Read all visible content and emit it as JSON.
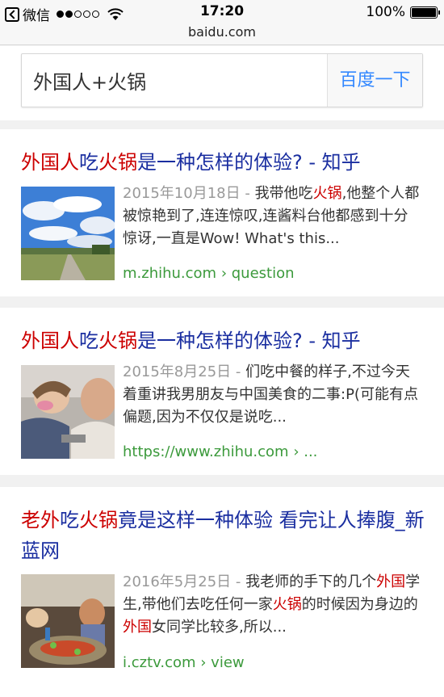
{
  "status_bar": {
    "back_app": "微信",
    "time": "17:20",
    "battery_text": "100%",
    "battery_level": 1.0,
    "signal_bars_filled": 2,
    "signal_bars_total": 5
  },
  "url_bar": {
    "domain": "baidu.com"
  },
  "search": {
    "query": "外国人+火锅",
    "button_label": "百度一下"
  },
  "results": [
    {
      "title": [
        {
          "t": "外国人",
          "hl": true
        },
        {
          "t": "吃",
          "hl": false
        },
        {
          "t": "火锅",
          "hl": true
        },
        {
          "t": "是一种怎样的体验? - 知乎",
          "hl": false
        }
      ],
      "thumb": "sky-field-photo",
      "snippet": [
        {
          "t": "2015年10月18日 - ",
          "cls": "date"
        },
        {
          "t": "我带他吃",
          "cls": ""
        },
        {
          "t": "火锅",
          "cls": "hl"
        },
        {
          "t": ",他整个人都被惊艳到了,连连惊叹,连酱料台他都感到十分惊讶,一直是Wow! What's this...",
          "cls": ""
        }
      ],
      "url": "m.zhihu.com › question"
    },
    {
      "title": [
        {
          "t": "外国人",
          "hl": true
        },
        {
          "t": "吃",
          "hl": false
        },
        {
          "t": "火锅",
          "hl": true
        },
        {
          "t": "是一种怎样的体验? - 知乎",
          "hl": false
        }
      ],
      "thumb": "people-photo",
      "snippet": [
        {
          "t": "2015年8月25日 - ",
          "cls": "date"
        },
        {
          "t": "们吃中餐的样子,不过今天着重讲我男朋友与中国美食的二事:P(可能有点偏题,因为不仅仅是说吃...",
          "cls": ""
        }
      ],
      "url": "https://www.zhihu.com › ..."
    },
    {
      "title": [
        {
          "t": "老外",
          "hl": true
        },
        {
          "t": "吃",
          "hl": false
        },
        {
          "t": "火锅",
          "hl": true
        },
        {
          "t": "竟是这样一种体验 看完让人捧腹_新蓝网",
          "hl": false
        }
      ],
      "thumb": "hotpot-dinner-photo",
      "snippet": [
        {
          "t": "2016年5月25日 - ",
          "cls": "date"
        },
        {
          "t": "我老师的手下的几个",
          "cls": ""
        },
        {
          "t": "外国",
          "cls": "hl"
        },
        {
          "t": "学生,带他们去吃任何一家",
          "cls": ""
        },
        {
          "t": "火锅",
          "cls": "hl"
        },
        {
          "t": "的时候因为身边的",
          "cls": ""
        },
        {
          "t": "外国",
          "cls": "hl"
        },
        {
          "t": "女同学比较多,所以...",
          "cls": ""
        }
      ],
      "url": "i.cztv.com › view"
    }
  ],
  "colors": {
    "title": "#1a2ea0",
    "highlight": "#cc0000",
    "url": "#3c9a3c",
    "date": "#999999",
    "button_text": "#3388ff"
  }
}
